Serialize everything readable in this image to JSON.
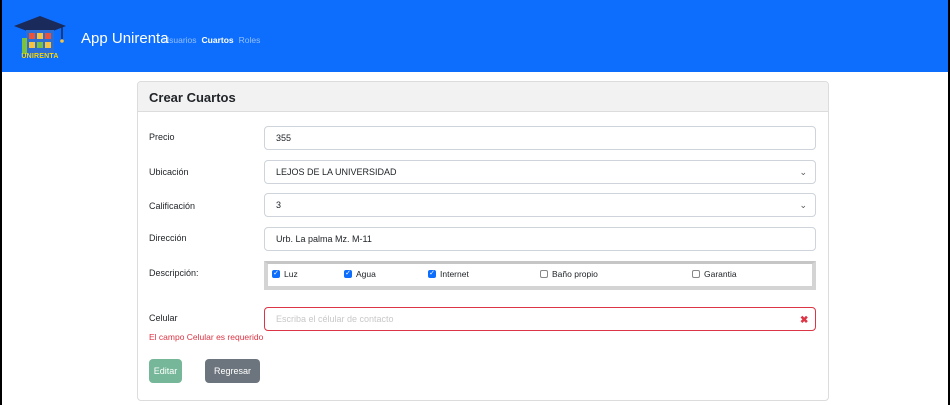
{
  "navbar": {
    "logo_text": "UNIRENTA",
    "brand": "App Unirenta",
    "links": [
      {
        "label": "Usuarios",
        "active": false
      },
      {
        "label": "Cuartos",
        "active": true
      },
      {
        "label": "Roles",
        "active": false
      }
    ]
  },
  "form": {
    "title": "Crear Cuartos",
    "precio": {
      "label": "Precio",
      "value": "355"
    },
    "ubicacion": {
      "label": "Ubicación",
      "value": "LEJOS DE LA UNIVERSIDAD"
    },
    "calificacion": {
      "label": "Calificación",
      "value": "3"
    },
    "direccion": {
      "label": "Dirección",
      "value": "Urb. La palma Mz. M-11"
    },
    "descripcion": {
      "label": "Descripción:",
      "options": [
        {
          "label": "Luz",
          "checked": true
        },
        {
          "label": "Agua",
          "checked": true
        },
        {
          "label": "Internet",
          "checked": true
        },
        {
          "label": "Baño propio",
          "checked": false
        },
        {
          "label": "Garantia",
          "checked": false
        }
      ]
    },
    "celular": {
      "label": "Celular",
      "value": "",
      "placeholder": "Escriba el célular de contacto",
      "error": "El campo Celular es requerido"
    },
    "buttons": {
      "edit": "Editar",
      "back": "Regresar"
    }
  },
  "colors": {
    "primary": "#0d6efd",
    "danger": "#dc3545",
    "success_disabled": "#75b798",
    "secondary": "#6c757d"
  },
  "icons": [
    "graduation-cap-logo",
    "chevron-down-icon",
    "x-icon"
  ]
}
